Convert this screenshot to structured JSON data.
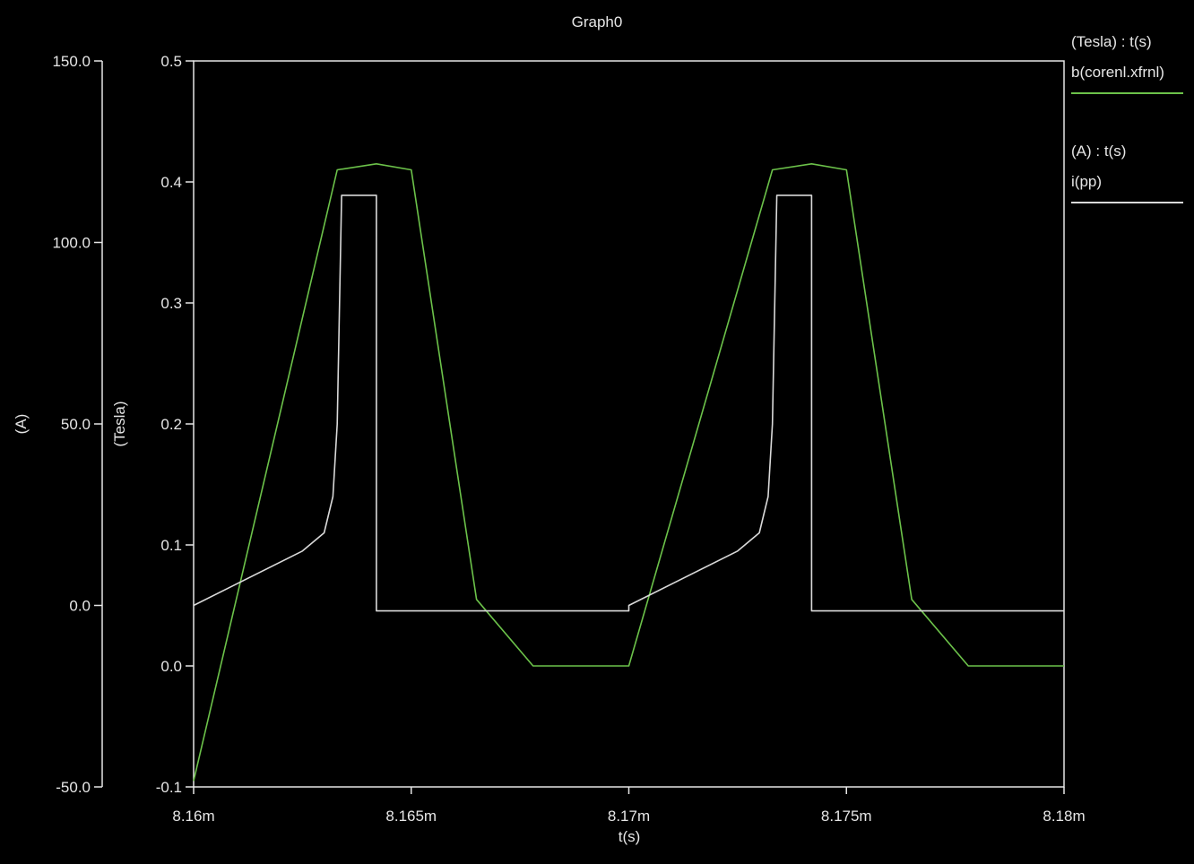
{
  "chart_data": {
    "type": "line",
    "title": "Graph0",
    "xlabel": "t(s)",
    "xlim": [
      0.00816,
      0.00818
    ],
    "x_ticks": [
      {
        "v": 0.00816,
        "label": "8.16m"
      },
      {
        "v": 0.008165,
        "label": "8.165m"
      },
      {
        "v": 0.00817,
        "label": "8.17m"
      },
      {
        "v": 0.008175,
        "label": "8.175m"
      },
      {
        "v": 0.00818,
        "label": "8.18m"
      }
    ],
    "axes": {
      "amps": {
        "label": "(A)",
        "ylim": [
          -50,
          150
        ],
        "ticks": [
          {
            "v": 150,
            "label": "150.0"
          },
          {
            "v": 100,
            "label": "100.0"
          },
          {
            "v": 50,
            "label": "50.0"
          },
          {
            "v": 0,
            "label": "0.0"
          },
          {
            "v": -50,
            "label": "-50.0"
          }
        ]
      },
      "tesla": {
        "label": "(Tesla)",
        "ylim": [
          -0.1,
          0.5
        ],
        "ticks": [
          {
            "v": 0.5,
            "label": "0.5"
          },
          {
            "v": 0.4,
            "label": "0.4"
          },
          {
            "v": 0.3,
            "label": "0.3"
          },
          {
            "v": 0.2,
            "label": "0.2"
          },
          {
            "v": 0.1,
            "label": "0.1"
          },
          {
            "v": 0.0,
            "label": "0.0"
          },
          {
            "v": -0.1,
            "label": "-0.1"
          }
        ]
      }
    },
    "legend_position": "right",
    "series": [
      {
        "name": "b(corenl.xfrnl)",
        "header": "(Tesla) : t(s)",
        "axis": "tesla",
        "color": "#6cc24a",
        "points": [
          [
            0.00816,
            -0.095
          ],
          [
            0.0081633,
            0.41
          ],
          [
            0.0081642,
            0.415
          ],
          [
            0.008165,
            0.41
          ],
          [
            0.0081665,
            0.055
          ],
          [
            0.0081678,
            0.0
          ],
          [
            0.00817,
            0.0
          ],
          [
            0.0081733,
            0.41
          ],
          [
            0.0081742,
            0.415
          ],
          [
            0.008175,
            0.41
          ],
          [
            0.0081765,
            0.055
          ],
          [
            0.0081778,
            0.0
          ],
          [
            0.00818,
            0.0
          ]
        ]
      },
      {
        "name": "i(pp)",
        "header": "(A) : t(s)",
        "axis": "amps",
        "color": "#d9d9d9",
        "points": [
          [
            0.00816,
            0.0
          ],
          [
            0.0081625,
            15.0
          ],
          [
            0.008163,
            20.0
          ],
          [
            0.0081632,
            30.0
          ],
          [
            0.0081633,
            50.0
          ],
          [
            0.0081634,
            113.0
          ],
          [
            0.0081642,
            113.0
          ],
          [
            0.0081642,
            -1.5
          ],
          [
            0.00817,
            -1.5
          ],
          [
            0.00817,
            0.0
          ],
          [
            0.0081725,
            15.0
          ],
          [
            0.008173,
            20.0
          ],
          [
            0.0081732,
            30.0
          ],
          [
            0.0081733,
            50.0
          ],
          [
            0.0081734,
            113.0
          ],
          [
            0.0081742,
            113.0
          ],
          [
            0.0081742,
            -1.5
          ],
          [
            0.00818,
            -1.5
          ]
        ]
      }
    ]
  }
}
